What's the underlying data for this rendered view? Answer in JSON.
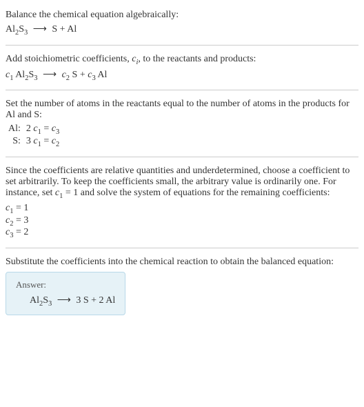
{
  "instruction": "Balance the chemical equation algebraically:",
  "unbalanced_equation_html": "Al<span class='subp'>2</span>S<span class='subp'>3</span> <span class='arrow'>⟶</span> S + Al",
  "step_coeffs": {
    "text_html": "Add stoichiometric coefficients, <span class='ital'>c<span class='sub'>i</span></span>, to the reactants and products:",
    "equation_html": "<span class='ital'>c</span><span class='subp'>1</span> Al<span class='subp'>2</span>S<span class='subp'>3</span> <span class='arrow'>⟶</span> <span class='ital'>c</span><span class='subp'>2</span> S + <span class='ital'>c</span><span class='subp'>3</span> Al"
  },
  "step_atoms": {
    "text": "Set the number of atoms in the reactants equal to the number of atoms in the products for Al and S:",
    "rows": [
      {
        "label": "Al:",
        "equation_html": "2 <span class='ital'>c</span><span class='subp'>1</span> = <span class='ital'>c</span><span class='subp'>3</span>"
      },
      {
        "label": "S:",
        "equation_html": "3 <span class='ital'>c</span><span class='subp'>1</span> = <span class='ital'>c</span><span class='subp'>2</span>"
      }
    ]
  },
  "step_solve": {
    "text_html": "Since the coefficients are relative quantities and underdetermined, choose a coefficient to set arbitrarily. To keep the coefficients small, the arbitrary value is ordinarily one. For instance, set <span class='ital'>c</span><span class='subp'>1</span> = 1 and solve the system of equations for the remaining coefficients:",
    "solutions": [
      {
        "html": "<span class='ital'>c</span><span class='subp'>1</span> = 1"
      },
      {
        "html": "<span class='ital'>c</span><span class='subp'>2</span> = 3"
      },
      {
        "html": "<span class='ital'>c</span><span class='subp'>3</span> = 2"
      }
    ]
  },
  "step_substitute": "Substitute the coefficients into the chemical reaction to obtain the balanced equation:",
  "answer": {
    "label": "Answer:",
    "equation_html": "Al<span class='subp'>2</span>S<span class='subp'>3</span> <span class='arrow'>⟶</span> 3 S + 2 Al"
  },
  "chart_data": {
    "type": "table",
    "reaction": {
      "reactants": [
        {
          "formula": "Al2S3",
          "coefficient": 1
        }
      ],
      "products": [
        {
          "formula": "S",
          "coefficient": 3
        },
        {
          "formula": "Al",
          "coefficient": 2
        }
      ]
    },
    "atom_balance": [
      {
        "element": "Al",
        "equation": "2 c1 = c3"
      },
      {
        "element": "S",
        "equation": "3 c1 = c2"
      }
    ],
    "coefficients": {
      "c1": 1,
      "c2": 3,
      "c3": 2
    }
  }
}
